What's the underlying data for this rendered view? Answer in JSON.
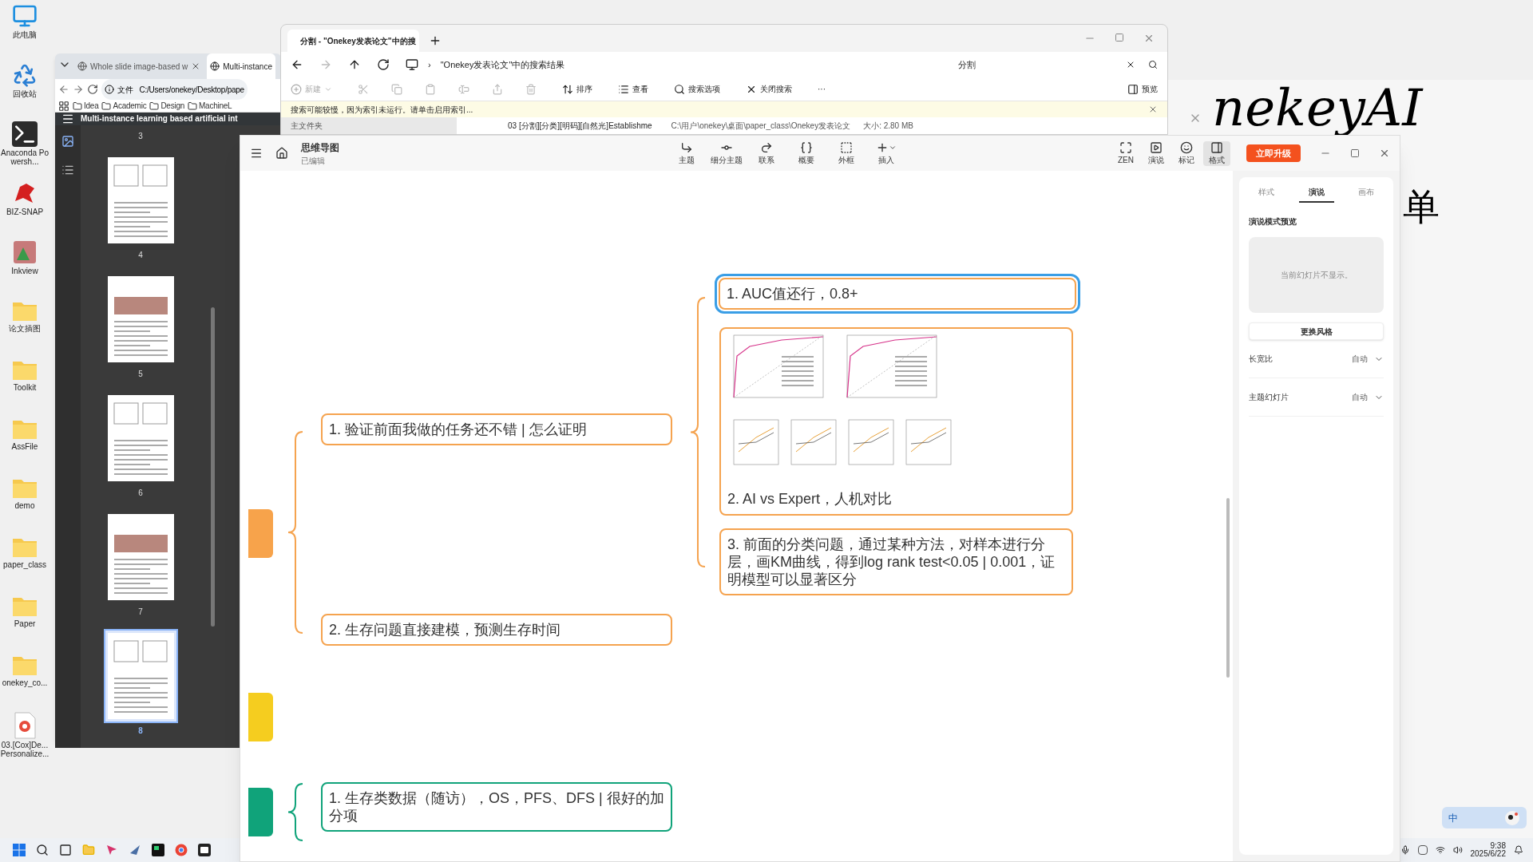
{
  "desktop_icons": [
    {
      "label": "此电脑",
      "kind": "pc"
    },
    {
      "label": "回收站",
      "kind": "recycle"
    },
    {
      "label": "Anaconda Powersh...",
      "kind": "terminal"
    },
    {
      "label": "BIZ-SNAP",
      "kind": "app"
    },
    {
      "label": "Inkview",
      "kind": "picture"
    },
    {
      "label": "论文插图",
      "kind": "folder"
    },
    {
      "label": "Toolkit",
      "kind": "folder"
    },
    {
      "label": "AssFile",
      "kind": "folder"
    },
    {
      "label": "demo",
      "kind": "folder"
    },
    {
      "label": "paper_class",
      "kind": "folder"
    },
    {
      "label": "Paper",
      "kind": "folder"
    },
    {
      "label": "onekey_co...",
      "kind": "folder"
    },
    {
      "label": "03.[Cox]De... Personalize...",
      "kind": "pdf"
    }
  ],
  "background_window": {
    "text": "nekeyAI",
    "text_2": "单"
  },
  "pdf_window": {
    "tabs": [
      {
        "label": "Whole slide image-based w",
        "selected": false
      },
      {
        "label": "Multi-instance",
        "selected": true
      }
    ],
    "address_prefix": "文件",
    "address": "C:/Users/onekey/Desktop/pape",
    "bookmarks": [
      "Idea",
      "Academic",
      "Design",
      "MachineL"
    ],
    "title": "Multi-instance learning based artificial int",
    "pages": [
      {
        "number": "3",
        "kind": "cut",
        "selected": false
      },
      {
        "number": "4",
        "kind": "figure",
        "selected": false
      },
      {
        "number": "5",
        "kind": "photo",
        "selected": false
      },
      {
        "number": "6",
        "kind": "figure",
        "selected": false
      },
      {
        "number": "7",
        "kind": "photo",
        "selected": false
      },
      {
        "number": "8",
        "kind": "figure",
        "selected": true
      }
    ]
  },
  "explorer": {
    "tab_title": "分割 - \"Onekey发表论文\"中的搜",
    "address_separator": "›",
    "address": "\"Onekey发表论文\"中的搜索结果",
    "search_value": "分割",
    "toolbar": [
      {
        "label": "新建",
        "disabled": true
      },
      {
        "label": "排序",
        "disabled": false
      },
      {
        "label": "查看",
        "disabled": false
      },
      {
        "label": "搜索选项",
        "disabled": false
      },
      {
        "label": "关闭搜索",
        "disabled": false
      },
      {
        "label": "···",
        "disabled": false
      }
    ],
    "preview_button": "预览",
    "notice": "搜索可能较慢，因为索引未运行。请单击启用索引...",
    "nav_item": "主文件夹",
    "result_name": "03 [分割][分类][明码][自然光]Establishme",
    "result_path": "C:\\用户\\onekey\\桌面\\paper_class\\Onekey发表论文",
    "result_size": "大小: 2.80 MB"
  },
  "mindmap": {
    "title": "思维导图",
    "status": "已编辑",
    "tools": [
      {
        "label": "主题"
      },
      {
        "label": "细分主题"
      },
      {
        "label": "联系"
      },
      {
        "label": "概要"
      },
      {
        "label": "外框"
      },
      {
        "label": "插入"
      }
    ],
    "view_tools": [
      {
        "label": "ZEN",
        "selected": false
      },
      {
        "label": "演说",
        "selected": false
      },
      {
        "label": "标记",
        "selected": false
      },
      {
        "label": "格式",
        "selected": true
      }
    ],
    "upgrade_button": "立即升级",
    "branches": [
      {
        "color": "#f7a34b"
      },
      {
        "color": "#f5cd1f"
      },
      {
        "color": "#10a37a"
      }
    ],
    "nodes": [
      {
        "kind": "text",
        "text": "1. AUC值还行，0.8+",
        "color": "#f5a34f",
        "selected": true
      },
      {
        "kind": "image",
        "text": "2. AI vs Expert，人机对比",
        "color": "#f5a34f",
        "selected": false
      },
      {
        "kind": "text",
        "text": "1. 验证前面我做的任务还不错 | 怎么证明",
        "color": "#f5a34f",
        "selected": false
      },
      {
        "kind": "text",
        "text": "3. 前面的分类问题，通过某种方法，对样本进行分层，画KM曲线，得到log rank test<0.05 | 0.001，证明模型可以显著区分",
        "color": "#f5a34f",
        "selected": false
      },
      {
        "kind": "text",
        "text": "2. 生存问题直接建模，预测生存时间",
        "color": "#f5a34f",
        "selected": false
      },
      {
        "kind": "text",
        "text": "1. 生存类数据（随访），OS，PFS、DFS | 很好的加分项",
        "color": "#10a37a",
        "selected": false
      }
    ],
    "panel": {
      "tabs": [
        {
          "label": "样式",
          "selected": false
        },
        {
          "label": "演说",
          "selected": true
        },
        {
          "label": "画布",
          "selected": false
        }
      ],
      "heading": "演说模式预览",
      "preview_text": "当前幻灯片不显示。",
      "style_button": "更换风格",
      "settings": [
        {
          "label": "长宽比",
          "value": "自动"
        },
        {
          "label": "主题幻灯片",
          "value": "自动"
        }
      ]
    }
  },
  "taskbar": {
    "time": "9:38",
    "date": "2025/6/22"
  },
  "ime": {
    "label": "中"
  }
}
